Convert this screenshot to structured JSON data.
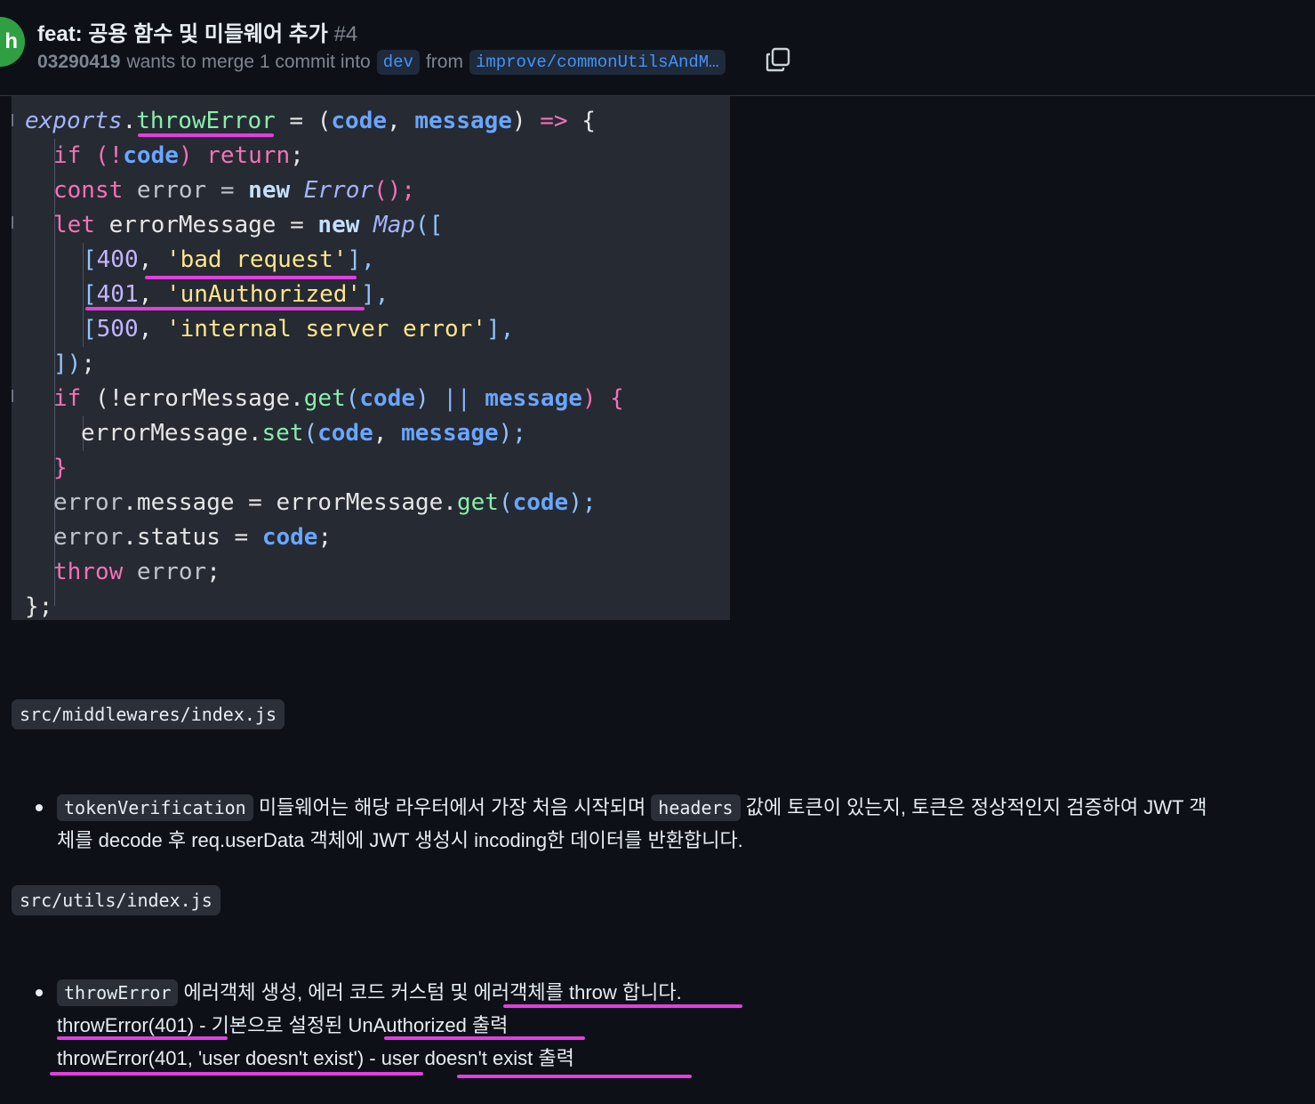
{
  "header": {
    "avatar_letter": "h",
    "title": "feat: 공용 함수 및 미들웨어 추가",
    "number": "#4",
    "author": "03290419",
    "merge_text": "wants to merge 1 commit into",
    "base_branch": "dev",
    "from_text": "from",
    "head_branch": "improve/commonUtilsAndM…"
  },
  "code": {
    "l1": {
      "a": "exports",
      "b": ".",
      "c": "throwError",
      "d": " = (",
      "e": "code",
      "f": ", ",
      "g": "message",
      "h": ") ",
      "i": "=>",
      "j": " {"
    },
    "l2": {
      "a": "if",
      "b": " (!",
      "c": "code",
      "d": ") ",
      "e": "return",
      "f": ";"
    },
    "l3": {
      "a": "const",
      "b": " error = ",
      "c": "new",
      "d": " ",
      "e": "Error",
      "f": "();"
    },
    "l4": {
      "a": "let",
      "b": " errorMessage = ",
      "c": "new",
      "d": " ",
      "e": "Map",
      "f": "(["
    },
    "l5": {
      "a": "[",
      "b": "400",
      "c": ", ",
      "d": "'bad request'",
      "e": "],"
    },
    "l6": {
      "a": "[",
      "b": "401",
      "c": ", ",
      "d": "'unAuthorized'",
      "e": "],"
    },
    "l7": {
      "a": "[",
      "b": "500",
      "c": ", ",
      "d": "'internal server error'",
      "e": "],"
    },
    "l8": {
      "a": "])",
      "b": ";"
    },
    "l9": {
      "a": "if",
      "b": " (!errorMessage.",
      "c": "get",
      "d": "(",
      "e": "code",
      "f": ") ",
      "g": "||",
      "h": " ",
      "i": "message",
      "j": ") {"
    },
    "l10": {
      "a": "errorMessage.",
      "b": "set",
      "c": "(",
      "d": "code",
      "e": ", ",
      "f": "message",
      "g": ");"
    },
    "l11": {
      "a": "}"
    },
    "l12": {
      "a": "error",
      "b": ".message = errorMessage.",
      "c": "get",
      "d": "(",
      "e": "code",
      "f": ");"
    },
    "l13": {
      "a": "error",
      "b": ".status = ",
      "c": "code",
      "d": ";"
    },
    "l14": {
      "a": "throw",
      "b": " error",
      "c": ";"
    },
    "l15": {
      "a": "};"
    }
  },
  "sections": {
    "middleware_path": "src/middlewares/index.js",
    "middleware_code": "tokenVerification",
    "middleware_text1": " 미들웨어는 해당 라우터에서 가장 처음 시작되며 ",
    "middleware_code2": "headers",
    "middleware_text2": " 값에 토큰이 있는지, 토큰은 정상적인지 검증하여 JWT 객",
    "middleware_text3": "체를 decode 후 req.userData 객체에 JWT 생성시 incoding한 데이터를 반환합니다.",
    "utils_path": "src/utils/index.js",
    "utils_code": "throwError",
    "utils_text1": " 에러객체 생성, 에러 코드 커스텀 및 에러객체를 throw 합니다.",
    "utils_line2": "throwError(401) - 기본으로 설정된 UnAuthorized 출력",
    "utils_line3": "throwError(401, 'user doesn't exist') - user doesn't exist 출력"
  },
  "colors": {
    "highlight": "#e23fdf",
    "accent_link": "#4493f8",
    "avatar": "#2ea043"
  }
}
